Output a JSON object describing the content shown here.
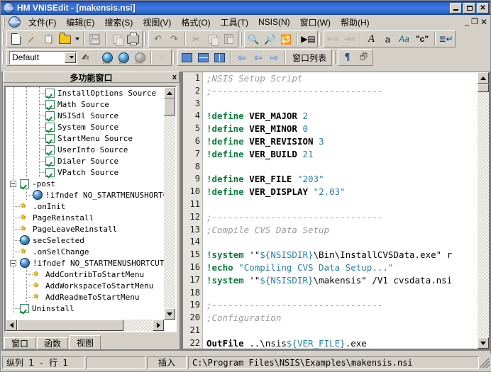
{
  "window": {
    "title": "HM VNISEdit - [makensis.nsi]",
    "app_icon": "globe-icon",
    "buttons": {
      "minimize": "_",
      "maximize": "□",
      "close": "×"
    },
    "mdi_buttons": {
      "minimize": "_",
      "restore": "❐",
      "close": "×"
    }
  },
  "menubar": {
    "items": [
      {
        "label": "文件(F)",
        "key": "F"
      },
      {
        "label": "编辑(E)",
        "key": "E"
      },
      {
        "label": "搜索(S)",
        "key": "S"
      },
      {
        "label": "视图(V)",
        "key": "V"
      },
      {
        "label": "格式(O)",
        "key": "O"
      },
      {
        "label": "工具(T)",
        "key": "T"
      },
      {
        "label": "NSIS(N)",
        "key": "N"
      },
      {
        "label": "窗口(W)",
        "key": "W"
      },
      {
        "label": "帮助(H)",
        "key": "H"
      }
    ]
  },
  "toolbar1": {
    "items": [
      {
        "name": "new-file-icon",
        "glyph": "doc"
      },
      {
        "name": "new-wizard-icon",
        "glyph": "wand"
      },
      {
        "name": "new-from-template-icon",
        "glyph": "clipboard"
      },
      {
        "name": "open-file-icon",
        "glyph": "folder"
      },
      {
        "name": "open-dropdown-icon",
        "glyph": "caret"
      },
      {
        "name": "save-icon",
        "glyph": "save"
      },
      {
        "name": "save-all-icon",
        "glyph": "saveall"
      },
      {
        "name": "print-icon",
        "glyph": "print"
      },
      {
        "name": "undo-icon",
        "glyph": "undo"
      },
      {
        "name": "redo-icon",
        "glyph": "redo"
      },
      {
        "name": "cut-icon",
        "glyph": "scissors"
      },
      {
        "name": "copy-icon",
        "glyph": "copy"
      },
      {
        "name": "paste-icon",
        "glyph": "paste"
      },
      {
        "name": "find-icon",
        "glyph": "binoculars"
      },
      {
        "name": "find-next-icon",
        "glyph": "binoculars-dots"
      },
      {
        "name": "replace-icon",
        "glyph": "binoculars-ab"
      },
      {
        "name": "goto-line-icon",
        "glyph": "goto"
      },
      {
        "name": "indent-decrease-icon",
        "glyph": "outdent"
      },
      {
        "name": "indent-increase-icon",
        "glyph": "indent"
      },
      {
        "name": "uppercase-icon",
        "glyph": "A"
      },
      {
        "name": "lowercase-icon",
        "glyph": "a"
      },
      {
        "name": "toggle-case-icon",
        "glyph": "Aa"
      },
      {
        "name": "comment-icon",
        "glyph": "\"c\""
      },
      {
        "name": "word-wrap-icon",
        "glyph": "wrap"
      }
    ]
  },
  "toolbar2": {
    "combo_value": "Default",
    "combo_name": "script-profile-combo",
    "items": [
      {
        "name": "apply-profile-icon",
        "glyph": "hand"
      },
      {
        "name": "compile-script-icon",
        "glyph": "globe-compile"
      },
      {
        "name": "compile-run-icon",
        "glyph": "globe-run"
      },
      {
        "name": "test-script-icon",
        "glyph": "globe-dim"
      },
      {
        "name": "run-icon",
        "glyph": "play"
      },
      {
        "name": "cascade-windows-icon",
        "glyph": "cascade"
      },
      {
        "name": "tile-horizontal-icon",
        "glyph": "tile-h"
      },
      {
        "name": "tile-vertical-icon",
        "glyph": "tile-v"
      },
      {
        "name": "previous-window-icon",
        "glyph": "arrow-left"
      },
      {
        "name": "back-icon",
        "glyph": "arrow-left"
      },
      {
        "name": "forward-icon",
        "glyph": "arrow-right"
      },
      {
        "name": "show-whitespace-icon",
        "glyph": "pilcrow"
      },
      {
        "name": "duplicate-window-icon",
        "glyph": "dupwin"
      }
    ],
    "window_list_label": "窗口列表"
  },
  "dock_panel": {
    "caption": "多功能窗口",
    "close_label": "x",
    "tabs": [
      {
        "label": "窗口",
        "active": false
      },
      {
        "label": "函数",
        "active": false
      },
      {
        "label": "视图",
        "active": true
      }
    ],
    "tree": [
      {
        "label": "InstallOptions Source",
        "indent": 3,
        "icon": "checkbox-checked",
        "expander": "none",
        "connector": "elbow"
      },
      {
        "label": "Math Source",
        "indent": 3,
        "icon": "checkbox-checked",
        "expander": "none",
        "connector": "elbow"
      },
      {
        "label": "NSISdl Source",
        "indent": 3,
        "icon": "checkbox-checked",
        "expander": "none",
        "connector": "elbow"
      },
      {
        "label": "System Source",
        "indent": 3,
        "icon": "checkbox-checked",
        "expander": "none",
        "connector": "elbow"
      },
      {
        "label": "StartMenu Source",
        "indent": 3,
        "icon": "checkbox-checked",
        "expander": "none",
        "connector": "elbow"
      },
      {
        "label": "UserInfo Source",
        "indent": 3,
        "icon": "checkbox-checked",
        "expander": "none",
        "connector": "elbow"
      },
      {
        "label": "Dialer Source",
        "indent": 3,
        "icon": "checkbox-checked",
        "expander": "none",
        "connector": "elbow"
      },
      {
        "label": "VPatch Source",
        "indent": 3,
        "icon": "checkbox-checked",
        "expander": "none",
        "connector": "elbow"
      },
      {
        "label": "-post",
        "indent": 1,
        "icon": "checkbox-checked",
        "expander": "minus",
        "connector": "none"
      },
      {
        "label": "!ifndef NO_STARTMENUSHORTC",
        "indent": 2,
        "icon": "ball-blue",
        "expander": "none",
        "connector": "elbow"
      },
      {
        "label": ".onInit",
        "indent": 1,
        "icon": "star",
        "expander": "none",
        "connector": "elbow"
      },
      {
        "label": "PageReinstall",
        "indent": 1,
        "icon": "star",
        "expander": "none",
        "connector": "elbow"
      },
      {
        "label": "PageLeaveReinstall",
        "indent": 1,
        "icon": "star",
        "expander": "none",
        "connector": "elbow"
      },
      {
        "label": "secSelected",
        "indent": 1,
        "icon": "ball-blue2",
        "expander": "none",
        "connector": "elbow"
      },
      {
        "label": ".onSelChange",
        "indent": 1,
        "icon": "star",
        "expander": "none",
        "connector": "elbow"
      },
      {
        "label": "!ifndef NO_STARTMENUSHORTCUTS",
        "indent": 1,
        "icon": "ball-blue",
        "expander": "minus",
        "connector": "none"
      },
      {
        "label": "AddContribToStartMenu",
        "indent": 2,
        "icon": "star",
        "expander": "none",
        "connector": "elbow"
      },
      {
        "label": "AddWorkspaceToStartMenu",
        "indent": 2,
        "icon": "star",
        "expander": "none",
        "connector": "elbow"
      },
      {
        "label": "AddReadmeToStartMenu",
        "indent": 2,
        "icon": "star",
        "expander": "none",
        "connector": "elbow"
      },
      {
        "label": "Uninstall",
        "indent": 1,
        "icon": "checkbox-checked",
        "expander": "none",
        "connector": "elbow"
      }
    ]
  },
  "editor": {
    "lines": [
      {
        "n": 1,
        "tokens": [
          {
            "t": ";NSIS Setup Script",
            "c": "cmt"
          }
        ]
      },
      {
        "n": 2,
        "tokens": [
          {
            "t": ";--------------------------------",
            "c": "cmt"
          }
        ]
      },
      {
        "n": 3,
        "tokens": []
      },
      {
        "n": 4,
        "tokens": [
          {
            "t": "!define",
            "c": "kw"
          },
          {
            "t": " ",
            "c": "id"
          },
          {
            "t": "VER_MAJOR",
            "c": "kw2"
          },
          {
            "t": " ",
            "c": "id"
          },
          {
            "t": "2",
            "c": "num"
          }
        ]
      },
      {
        "n": 5,
        "tokens": [
          {
            "t": "!define",
            "c": "kw"
          },
          {
            "t": " ",
            "c": "id"
          },
          {
            "t": "VER_MINOR",
            "c": "kw2"
          },
          {
            "t": " ",
            "c": "id"
          },
          {
            "t": "0",
            "c": "num"
          }
        ]
      },
      {
        "n": 6,
        "tokens": [
          {
            "t": "!define",
            "c": "kw"
          },
          {
            "t": " ",
            "c": "id"
          },
          {
            "t": "VER_REVISION",
            "c": "kw2"
          },
          {
            "t": " ",
            "c": "id"
          },
          {
            "t": "3",
            "c": "num"
          }
        ]
      },
      {
        "n": 7,
        "tokens": [
          {
            "t": "!define",
            "c": "kw"
          },
          {
            "t": " ",
            "c": "id"
          },
          {
            "t": "VER_BUILD",
            "c": "kw2"
          },
          {
            "t": " ",
            "c": "id"
          },
          {
            "t": "21",
            "c": "num"
          }
        ]
      },
      {
        "n": 8,
        "tokens": []
      },
      {
        "n": 9,
        "tokens": [
          {
            "t": "!define",
            "c": "kw"
          },
          {
            "t": " ",
            "c": "id"
          },
          {
            "t": "VER_FILE",
            "c": "kw2"
          },
          {
            "t": " ",
            "c": "id"
          },
          {
            "t": "\"203\"",
            "c": "str"
          }
        ]
      },
      {
        "n": 10,
        "tokens": [
          {
            "t": "!define",
            "c": "kw"
          },
          {
            "t": " ",
            "c": "id"
          },
          {
            "t": "VER_DISPLAY",
            "c": "kw2"
          },
          {
            "t": " ",
            "c": "id"
          },
          {
            "t": "\"2.03\"",
            "c": "str"
          }
        ]
      },
      {
        "n": 11,
        "tokens": []
      },
      {
        "n": 12,
        "tokens": [
          {
            "t": ";--------------------------------",
            "c": "cmt"
          }
        ]
      },
      {
        "n": 13,
        "tokens": [
          {
            "t": ";Compile CVS Data Setup",
            "c": "cmt"
          }
        ]
      },
      {
        "n": 14,
        "tokens": []
      },
      {
        "n": 15,
        "tokens": [
          {
            "t": "!system",
            "c": "kw"
          },
          {
            "t": " '\"",
            "c": "id"
          },
          {
            "t": "${NSISDIR}",
            "c": "var"
          },
          {
            "t": "\\Bin\\InstallCVSData.exe\" r",
            "c": "id"
          }
        ]
      },
      {
        "n": 16,
        "tokens": [
          {
            "t": "!echo",
            "c": "kw"
          },
          {
            "t": " ",
            "c": "id"
          },
          {
            "t": "\"Compiling CVS Data Setup...\"",
            "c": "str"
          }
        ]
      },
      {
        "n": 17,
        "tokens": [
          {
            "t": "!system",
            "c": "kw"
          },
          {
            "t": " '\"",
            "c": "id"
          },
          {
            "t": "${NSISDIR}",
            "c": "var"
          },
          {
            "t": "\\makensis\" /V1 cvsdata.nsi",
            "c": "id"
          }
        ]
      },
      {
        "n": 18,
        "tokens": []
      },
      {
        "n": 19,
        "tokens": [
          {
            "t": ";--------------------------------",
            "c": "cmt"
          }
        ]
      },
      {
        "n": 20,
        "tokens": [
          {
            "t": ";Configuration",
            "c": "cmt"
          }
        ]
      },
      {
        "n": 21,
        "tokens": []
      },
      {
        "n": 22,
        "tokens": [
          {
            "t": "OutFile",
            "c": "kw2"
          },
          {
            "t": " ..\\nsis",
            "c": "id"
          },
          {
            "t": "${VER_FILE}",
            "c": "var"
          },
          {
            "t": ".exe",
            "c": "id"
          }
        ]
      }
    ]
  },
  "statusbar": {
    "position": "纵列 1 - 行 1",
    "insert_mode": "插入",
    "file_path": "C:\\Program Files\\NSIS\\Examples\\makensis.nsi"
  },
  "colors": {
    "title_gradient_start": "#0a246a",
    "title_gradient_end": "#3f7ae0",
    "face": "#d4d0c8",
    "comment": "#9a9a9a",
    "keyword": "#0a7a3c",
    "number": "#2a7fa8",
    "string": "#2a7fa8",
    "gutter": "#e6e3dc"
  }
}
